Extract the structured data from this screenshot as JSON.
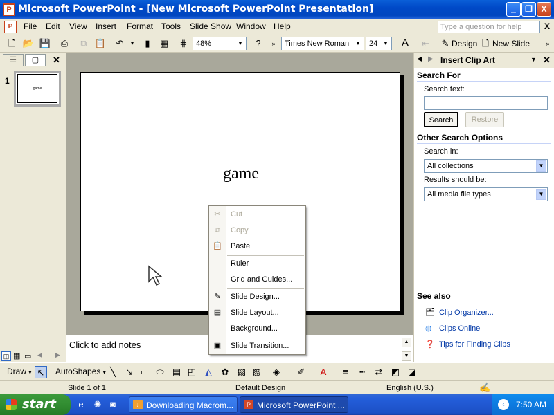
{
  "window": {
    "title": "Microsoft PowerPoint - [New Microsoft PowerPoint Presentation]",
    "controls": [
      "_",
      "❐",
      "X"
    ]
  },
  "menu": {
    "items": [
      "File",
      "Edit",
      "View",
      "Insert",
      "Format",
      "Tools",
      "Slide Show",
      "Window",
      "Help"
    ],
    "help_placeholder": "Type a question for help",
    "close_doc": "X"
  },
  "toolbar": {
    "zoom": "48%",
    "font": "Times New Roman",
    "size": "24",
    "design_label": "Design",
    "new_slide_label": "New Slide"
  },
  "outline": {
    "slide_number": "1",
    "thumb_text": "game"
  },
  "slide": {
    "text": "game"
  },
  "notes": {
    "placeholder": "Click to add notes"
  },
  "task_pane": {
    "title": "Insert Clip Art",
    "search_for": "Search For",
    "search_text_label": "Search text:",
    "search_text_value": "",
    "search_btn": "Search",
    "restore_btn": "Restore",
    "other_options": "Other Search Options",
    "search_in_label": "Search in:",
    "search_in_value": "All collections",
    "results_label": "Results should be:",
    "results_value": "All media file types",
    "see_also": "See also",
    "links": [
      "Clip Organizer...",
      "Clips Online",
      "Tips for Finding Clips"
    ]
  },
  "context_menu": {
    "items": [
      {
        "label": "Cut",
        "icon": "scissors-icon",
        "enabled": false
      },
      {
        "label": "Copy",
        "icon": "copy-icon",
        "enabled": false
      },
      {
        "label": "Paste",
        "icon": "paste-icon",
        "enabled": true
      },
      {
        "label": "Ruler",
        "icon": "",
        "enabled": true
      },
      {
        "label": "Grid and Guides...",
        "icon": "",
        "enabled": true
      },
      {
        "label": "Slide Design...",
        "icon": "slide-design-icon",
        "enabled": true
      },
      {
        "label": "Slide Layout...",
        "icon": "slide-layout-icon",
        "enabled": true
      },
      {
        "label": "Background...",
        "icon": "",
        "enabled": true
      },
      {
        "label": "Slide Transition...",
        "icon": "slide-transition-icon",
        "enabled": true
      }
    ]
  },
  "drawing": {
    "draw_label": "Draw",
    "autoshapes_label": "AutoShapes"
  },
  "status": {
    "slide": "Slide 1 of 1",
    "design": "Default Design",
    "language": "English (U.S.)"
  },
  "taskbar": {
    "start": "start",
    "tasks": [
      "Downloading Macrom...",
      "Microsoft PowerPoint ..."
    ],
    "clock": "7:50 AM"
  },
  "colors": {
    "titlebar": "#0a5fd8",
    "workspace": "#a9a89b",
    "link": "#0037a6",
    "start_green": "#2f8a2f"
  }
}
